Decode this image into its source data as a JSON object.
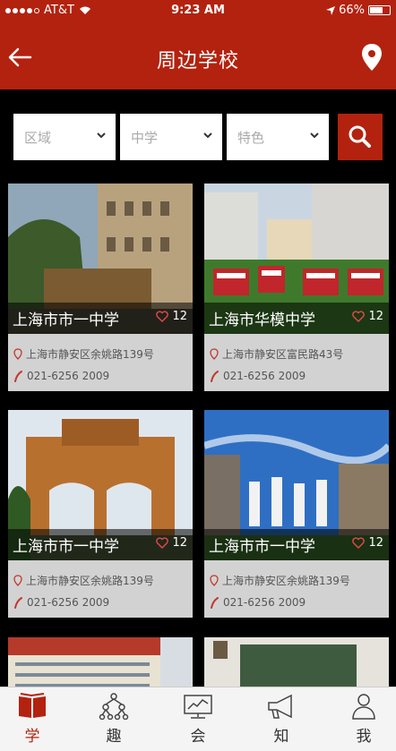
{
  "status_bar": {
    "carrier": "AT&T",
    "time": "9:23 AM",
    "battery": "66%"
  },
  "header": {
    "title": "周边学校"
  },
  "filters": {
    "region": "区域",
    "level": "中学",
    "feature": "特色"
  },
  "schools": [
    {
      "name": "上海市市一中学",
      "likes": "12",
      "address": "上海市静安区余姚路139号",
      "phone": "021-6256 2009"
    },
    {
      "name": "上海市华模中学",
      "likes": "12",
      "address": "上海市静安区富民路43号",
      "phone": "021-6256 2009"
    },
    {
      "name": "上海市市一中学",
      "likes": "12",
      "address": "上海市静安区余姚路139号",
      "phone": "021-6256 2009"
    },
    {
      "name": "上海市市一中学",
      "likes": "12",
      "address": "上海市静安区余姚路139号",
      "phone": "021-6256 2009"
    }
  ],
  "tabs": [
    {
      "label": "学",
      "icon": "book-icon",
      "active": true
    },
    {
      "label": "趣",
      "icon": "network-icon",
      "active": false
    },
    {
      "label": "会",
      "icon": "presentation-icon",
      "active": false
    },
    {
      "label": "知",
      "icon": "megaphone-icon",
      "active": false
    },
    {
      "label": "我",
      "icon": "person-icon",
      "active": false
    }
  ],
  "colors": {
    "brand": "#b3220f",
    "card_info_bg": "#d2d2d2",
    "tab_bg": "#f4f4f4"
  }
}
